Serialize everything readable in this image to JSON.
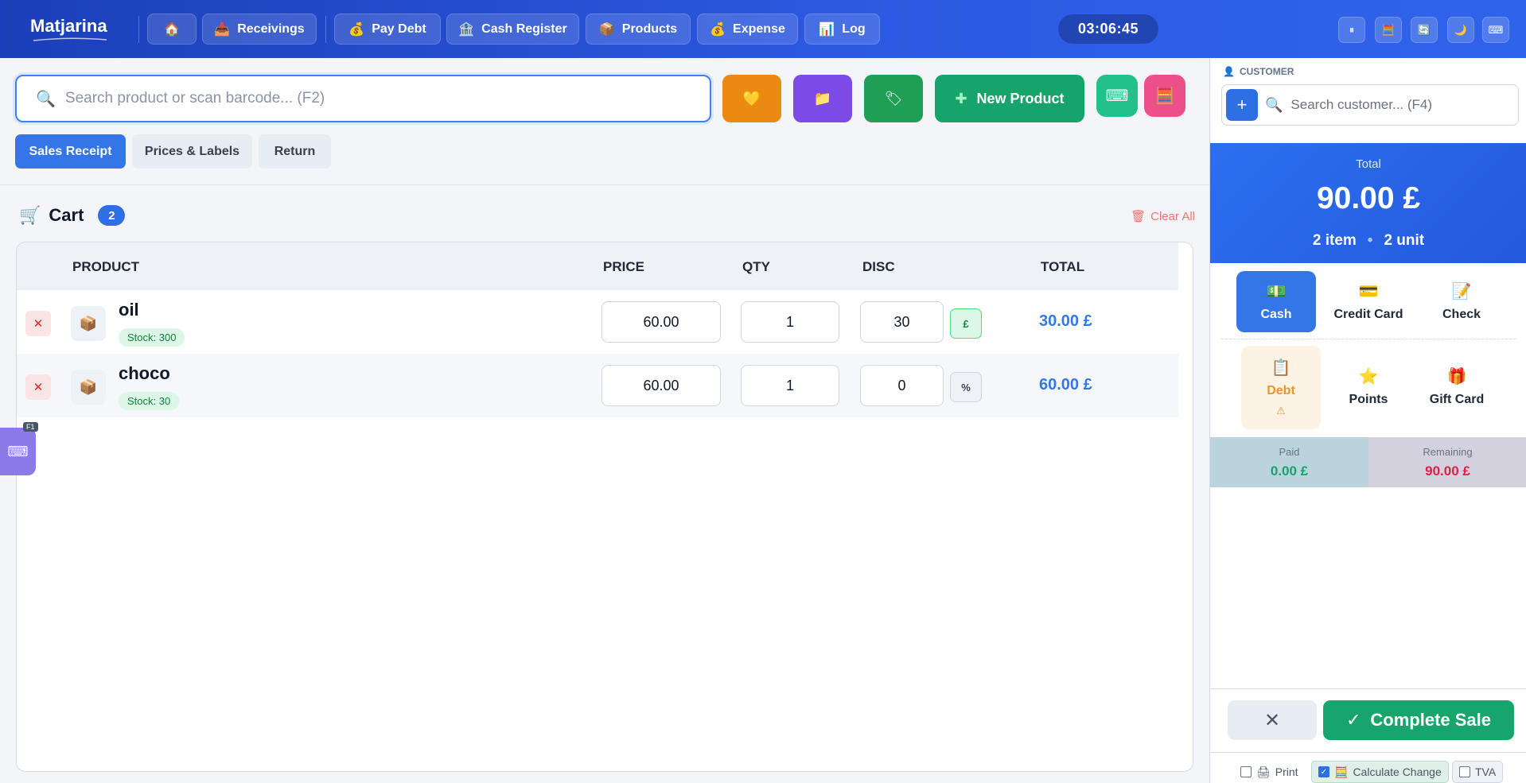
{
  "app": {
    "brand": "Matjarina",
    "clock": "03:06:45"
  },
  "nav": [
    {
      "icon": "🏠",
      "label": ""
    },
    {
      "icon": "📥",
      "label": "Receivings"
    },
    {
      "icon": "💰",
      "label": "Pay Debt"
    },
    {
      "icon": "🏦",
      "label": "Cash Register"
    },
    {
      "icon": "📦",
      "label": "Products"
    },
    {
      "icon": "💰",
      "label": "Expense"
    },
    {
      "icon": "📊",
      "label": "Log"
    }
  ],
  "tools": [
    {
      "icon": "⏸"
    },
    {
      "icon": "🧮"
    },
    {
      "icon": "🔄"
    },
    {
      "icon": "🌙"
    },
    {
      "icon": "⌨"
    }
  ],
  "search": {
    "placeholder": "Search product or scan barcode... (F2)",
    "value": ""
  },
  "quick": [
    {
      "icon": "💛",
      "color": "#ea8a10"
    },
    {
      "icon": "📁",
      "color": "#7c4ae6"
    },
    {
      "icon": "🏷",
      "color": "#1f9e55"
    }
  ],
  "new_product": {
    "icon": "✚",
    "label": "New Product"
  },
  "extra_buttons": [
    {
      "icon": "⌨",
      "color": "#22c08a"
    },
    {
      "icon": "🧮",
      "color": "#ec4f8a"
    }
  ],
  "tabs": [
    {
      "label": "Sales Receipt",
      "active": true
    },
    {
      "label": "Prices & Labels",
      "active": false
    },
    {
      "label": "Return",
      "active": false
    }
  ],
  "cart": {
    "title": "Cart",
    "count": "2",
    "clear_label": "Clear All",
    "columns": {
      "product": "PRODUCT",
      "price": "PRICE",
      "qty": "QTY",
      "disc": "DISC",
      "total": "TOTAL"
    },
    "rows": [
      {
        "name": "oil",
        "stock": "Stock: 300",
        "price": "60.00",
        "qty": "1",
        "disc": "30",
        "disc_type": "£",
        "total": "30.00 £"
      },
      {
        "name": "choco",
        "stock": "Stock: 30",
        "price": "60.00",
        "qty": "1",
        "disc": "0",
        "disc_type": "%",
        "total": "60.00 £"
      }
    ],
    "keyboard_hint": "F1"
  },
  "customer": {
    "label": "CUSTOMER",
    "placeholder": "Search customer... (F4)",
    "value": ""
  },
  "summary": {
    "label": "Total",
    "total": "90.00 £",
    "items": "2 item",
    "units": "2 unit"
  },
  "payments": [
    {
      "icon": "💵",
      "label": "Cash",
      "active": true
    },
    {
      "icon": "💳",
      "label": "Credit Card",
      "active": false
    },
    {
      "icon": "📝",
      "label": "Check",
      "active": false
    },
    {
      "icon": "📋",
      "label": "Debt",
      "warning": "⚠",
      "active": false
    },
    {
      "icon": "⭐",
      "label": "Points",
      "active": false
    },
    {
      "icon": "🎁",
      "label": "Gift Card",
      "active": false
    }
  ],
  "balance": {
    "paid_label": "Paid",
    "paid": "0.00 £",
    "remaining_label": "Remaining",
    "remaining": "90.00 £"
  },
  "actions": {
    "cancel_icon": "✕",
    "complete_icon": "✓",
    "complete": "Complete Sale"
  },
  "options": [
    {
      "icon": "🖨",
      "label": "Print",
      "checked": false
    },
    {
      "icon": "🧮",
      "label": "Calculate Change",
      "checked": true
    },
    {
      "icon": "",
      "label": "TVA",
      "checked": false
    }
  ],
  "colors": {
    "primary": "#2f6fe4",
    "success": "#17a56b",
    "danger": "#dc2626",
    "paid_text": "#16a46b",
    "remaining_text": "#e11d48"
  }
}
